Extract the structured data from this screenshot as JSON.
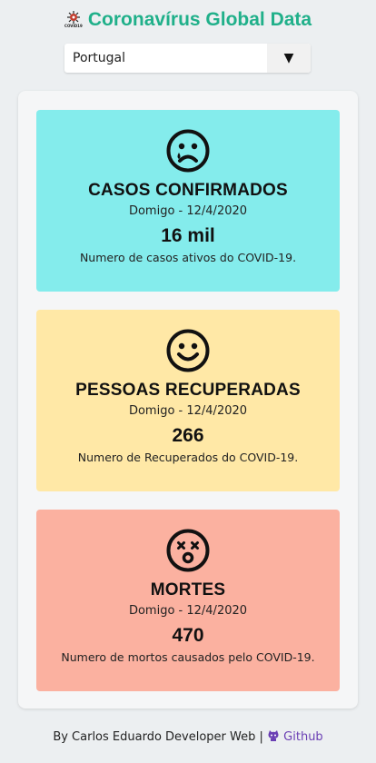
{
  "header": {
    "logo_text": "COVID19",
    "title": "Coronavírus Global Data"
  },
  "country_select": {
    "selected": "Portugal",
    "arrow": "▼"
  },
  "cards": [
    {
      "icon": "sad-face-icon",
      "title": "CASOS CONFIRMADOS",
      "date": "Domigo - 12/4/2020",
      "value": "16 mil",
      "description": "Numero de casos ativos do COVID-19.",
      "color": "#84ecec"
    },
    {
      "icon": "happy-face-icon",
      "title": "PESSOAS RECUPERADAS",
      "date": "Domigo - 12/4/2020",
      "value": "266",
      "description": "Numero de Recuperados do COVID-19.",
      "color": "#ffe8a6"
    },
    {
      "icon": "dead-face-icon",
      "title": "MORTES",
      "date": "Domigo - 12/4/2020",
      "value": "470",
      "description": "Numero de mortos causados pelo COVID-19.",
      "color": "#fbb1a0"
    }
  ],
  "footer": {
    "text": "By Carlos Eduardo Developer Web |",
    "link_label": "Github",
    "link_icon": "github-icon"
  }
}
